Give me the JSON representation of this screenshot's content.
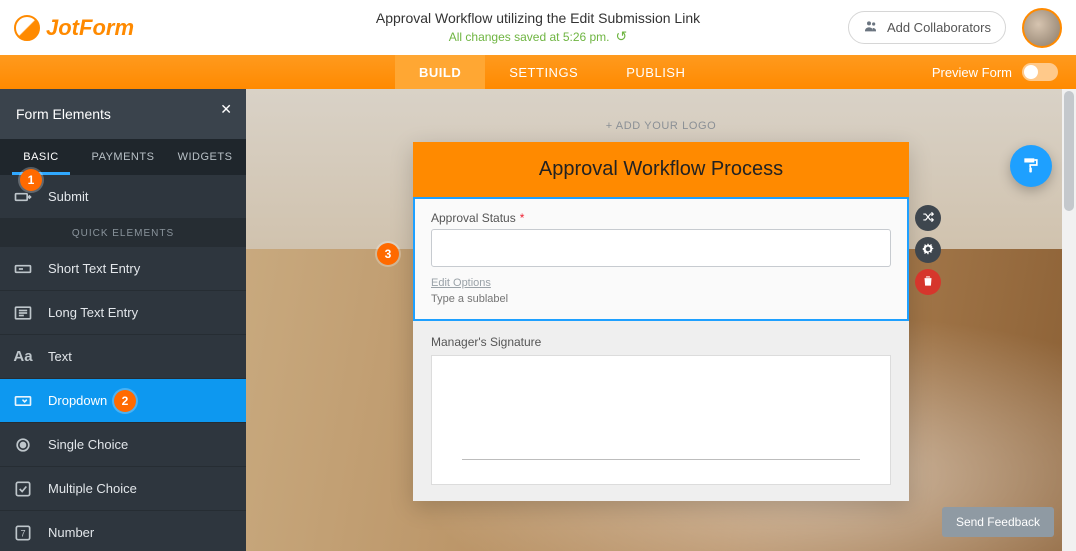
{
  "header": {
    "brand": "JotForm",
    "title": "Approval Workflow utilizing the Edit Submission Link",
    "save_status": "All changes saved at 5:26 pm.",
    "collaborators_btn": "Add Collaborators"
  },
  "tabs": {
    "build": "BUILD",
    "settings": "SETTINGS",
    "publish": "PUBLISH",
    "preview_label": "Preview Form"
  },
  "sidebar": {
    "title": "Form Elements",
    "tabs": {
      "basic": "BASIC",
      "payments": "PAYMENTS",
      "widgets": "WIDGETS"
    },
    "quick_label": "QUICK ELEMENTS",
    "items": {
      "submit": "Submit",
      "short_text": "Short Text Entry",
      "long_text": "Long Text Entry",
      "text": "Text",
      "dropdown": "Dropdown",
      "single_choice": "Single Choice",
      "multiple_choice": "Multiple Choice",
      "number": "Number"
    }
  },
  "canvas": {
    "add_logo": "+ ADD YOUR LOGO",
    "form_title": "Approval Workflow Process",
    "approval_label": "Approval Status",
    "edit_options": "Edit Options",
    "sublabel_placeholder": "Type a sublabel",
    "signature_label": "Manager's Signature",
    "send_feedback": "Send Feedback"
  },
  "steps": {
    "one": "1",
    "two": "2",
    "three": "3"
  }
}
